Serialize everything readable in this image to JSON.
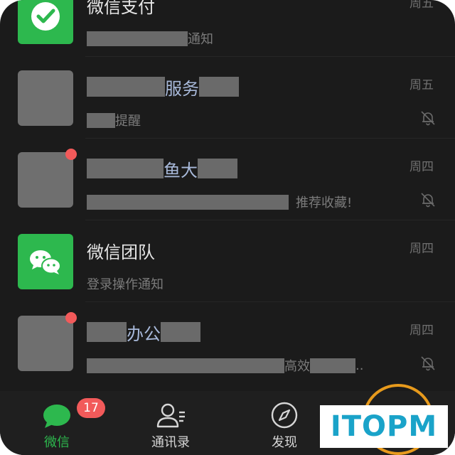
{
  "colors": {
    "background": "#1b1b1b",
    "wechat_green": "#2db84e",
    "badge_red": "#f25a5a",
    "name_blue": "#a8b9da",
    "logo_blue": "#1aa3c9"
  },
  "chats": [
    {
      "title": "微信支付",
      "subtitle_suffix": "通知",
      "date": "周五"
    },
    {
      "title_visible": "服务",
      "subtitle_visible": "提醒",
      "date": "周五",
      "muted": true
    },
    {
      "title_visible": "鱼大",
      "subtitle_suffix": "推荐收藏!",
      "date": "周四",
      "muted": true,
      "unread_dot": true
    },
    {
      "title": "微信团队",
      "subtitle": "登录操作通知",
      "date": "周四"
    },
    {
      "title_visible": "办公",
      "subtitle_visible": "高效",
      "subtitle_ellipsis": "..",
      "date": "周四",
      "muted": true,
      "unread_dot": true
    }
  ],
  "tabs": [
    {
      "label": "微信",
      "badge": "17",
      "icon": "chat-bubble-icon",
      "active": true
    },
    {
      "label": "通讯录",
      "icon": "contacts-icon"
    },
    {
      "label": "发现",
      "icon": "compass-icon"
    }
  ],
  "watermark": "ITOPM"
}
